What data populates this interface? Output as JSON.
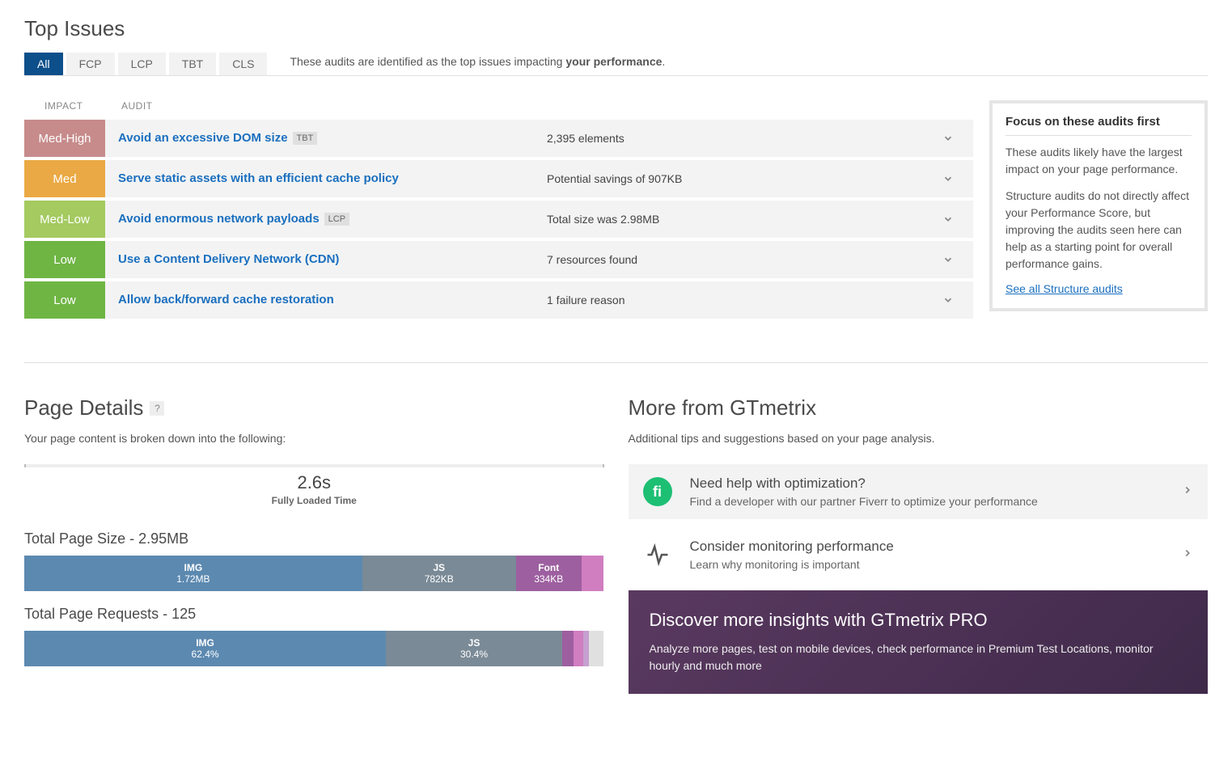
{
  "top_issues": {
    "title": "Top Issues",
    "tabs": [
      "All",
      "FCP",
      "LCP",
      "TBT",
      "CLS"
    ],
    "caption_prefix": "These audits are identified as the top issues impacting ",
    "caption_strong": "your performance",
    "caption_suffix": ".",
    "header_impact": "IMPACT",
    "header_audit": "AUDIT",
    "rows": [
      {
        "impact": "Med-High",
        "impact_cls": "impact-med-high",
        "audit": "Avoid an excessive DOM size",
        "tag": "TBT",
        "detail": "2,395 elements"
      },
      {
        "impact": "Med",
        "impact_cls": "impact-med",
        "audit": "Serve static assets with an efficient cache policy",
        "tag": "",
        "detail": "Potential savings of 907KB"
      },
      {
        "impact": "Med-Low",
        "impact_cls": "impact-med-low",
        "audit": "Avoid enormous network payloads",
        "tag": "LCP",
        "detail": "Total size was 2.98MB"
      },
      {
        "impact": "Low",
        "impact_cls": "impact-low",
        "audit": "Use a Content Delivery Network (CDN)",
        "tag": "",
        "detail": "7 resources found"
      },
      {
        "impact": "Low",
        "impact_cls": "impact-low",
        "audit": "Allow back/forward cache restoration",
        "tag": "",
        "detail": "1 failure reason"
      }
    ],
    "sidebar": {
      "title": "Focus on these audits first",
      "p1": "These audits likely have the largest impact on your page performance.",
      "p2": "Structure audits do not directly affect your Performance Score, but improving the audits seen here can help as a starting point for overall performance gains.",
      "link": "See all Structure audits"
    }
  },
  "page_details": {
    "title": "Page Details",
    "help": "?",
    "sub": "Your page content is broken down into the following:",
    "loaded_time": "2.6s",
    "loaded_caption": "Fully Loaded Time",
    "size_title": "Total Page Size - 2.95MB",
    "requests_title": "Total Page Requests - 125"
  },
  "chart_data": [
    {
      "type": "bar",
      "title": "Total Page Size - 2.95MB",
      "unit": "MB",
      "total": 2.95,
      "series": [
        {
          "name": "IMG",
          "label": "1.72MB",
          "value": 1.72,
          "color": "#5c89b0"
        },
        {
          "name": "JS",
          "label": "782KB",
          "value": 0.782,
          "color": "#7a8a96"
        },
        {
          "name": "Font",
          "label": "334KB",
          "value": 0.334,
          "color": "#9d5fa0"
        },
        {
          "name": "Other",
          "label": "",
          "value": 0.114,
          "color": "#d07ec0"
        }
      ]
    },
    {
      "type": "bar",
      "title": "Total Page Requests - 125",
      "unit": "%",
      "total": 100,
      "series": [
        {
          "name": "IMG",
          "label": "62.4%",
          "value": 62.4,
          "color": "#5c89b0"
        },
        {
          "name": "JS",
          "label": "30.4%",
          "value": 30.4,
          "color": "#7a8a96"
        },
        {
          "name": "A",
          "label": "",
          "value": 2.0,
          "color": "#9d5fa0"
        },
        {
          "name": "B",
          "label": "",
          "value": 1.6,
          "color": "#d07ec0"
        },
        {
          "name": "C",
          "label": "",
          "value": 1.0,
          "color": "#c6a0cf"
        },
        {
          "name": "D",
          "label": "",
          "value": 2.6,
          "color": "#e0e0e0"
        }
      ]
    }
  ],
  "more": {
    "title": "More from GTmetrix",
    "sub": "Additional tips and suggestions based on your page analysis.",
    "rows": [
      {
        "icon": "fi",
        "title": "Need help with optimization?",
        "sub": "Find a developer with our partner Fiverr to optimize your performance"
      },
      {
        "icon": "pulse",
        "title": "Consider monitoring performance",
        "sub": "Learn why monitoring is important"
      }
    ],
    "banner": {
      "title": "Discover more insights with GTmetrix PRO",
      "sub": "Analyze more pages, test on mobile devices, check performance in Premium Test Locations, monitor hourly and much more"
    }
  }
}
